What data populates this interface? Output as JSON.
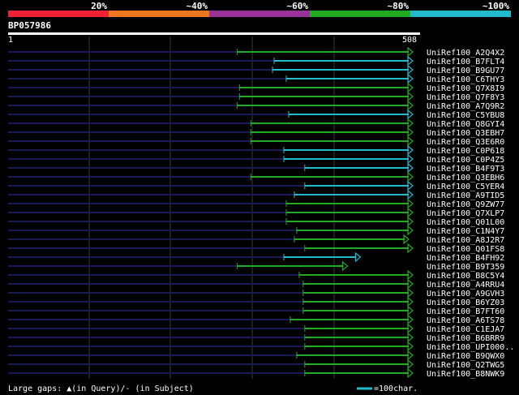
{
  "chart_data": {
    "type": "bar",
    "query_id": "BP057986",
    "query_length": 508,
    "scale_start": "1",
    "scale_end": "508",
    "identity_legend": [
      {
        "label": "20%",
        "color": "#ee2233"
      },
      {
        "label": "~40%",
        "color": "#ee7722"
      },
      {
        "label": "~60%",
        "color": "#993399"
      },
      {
        "label": "~80%",
        "color": "#22aa22"
      },
      {
        "label": "~100%",
        "color": "#22bbcc"
      }
    ],
    "gaps_legend": "Large gaps: ▲(in Query)/- (in Subject)",
    "scale_legend": "=100char.",
    "hits": [
      {
        "name": "UniRef100_A2Q4X2",
        "start": 285,
        "end": 503,
        "color": "#22aa22"
      },
      {
        "name": "UniRef100_B7FLT4",
        "start": 331,
        "end": 503,
        "color": "#22bbcc"
      },
      {
        "name": "UniRef100_B9GU77",
        "start": 329,
        "end": 503,
        "color": "#22bbcc"
      },
      {
        "name": "UniRef100_C6THY3",
        "start": 346,
        "end": 503,
        "color": "#22bbcc"
      },
      {
        "name": "UniRef100_Q7X8I9",
        "start": 288,
        "end": 503,
        "color": "#22aa22"
      },
      {
        "name": "UniRef100_Q7F8Y3",
        "start": 288,
        "end": 503,
        "color": "#22aa22"
      },
      {
        "name": "UniRef100_A7Q9R2",
        "start": 285,
        "end": 503,
        "color": "#22aa22"
      },
      {
        "name": "UniRef100_C5YBU8",
        "start": 349,
        "end": 503,
        "color": "#22bbcc"
      },
      {
        "name": "UniRef100_Q8GYI4",
        "start": 302,
        "end": 503,
        "color": "#22aa22"
      },
      {
        "name": "UniRef100_Q3EBH7",
        "start": 302,
        "end": 503,
        "color": "#22aa22"
      },
      {
        "name": "UniRef100_Q3E6R0",
        "start": 302,
        "end": 503,
        "color": "#22aa22"
      },
      {
        "name": "UniRef100_C0P618",
        "start": 343,
        "end": 503,
        "color": "#22bbcc"
      },
      {
        "name": "UniRef100_C0P4Z5",
        "start": 343,
        "end": 503,
        "color": "#22bbcc"
      },
      {
        "name": "UniRef100_B4F9T3",
        "start": 369,
        "end": 503,
        "color": "#22bbcc"
      },
      {
        "name": "UniRef100_Q3EBH6",
        "start": 302,
        "end": 503,
        "color": "#22aa22"
      },
      {
        "name": "UniRef100_C5YER4",
        "start": 369,
        "end": 503,
        "color": "#22bbcc"
      },
      {
        "name": "UniRef100_A9TID5",
        "start": 356,
        "end": 503,
        "color": "#22bbcc"
      },
      {
        "name": "UniRef100_Q9ZW77",
        "start": 346,
        "end": 503,
        "color": "#22aa22"
      },
      {
        "name": "UniRef100_Q7XLP7",
        "start": 346,
        "end": 503,
        "color": "#22aa22"
      },
      {
        "name": "UniRef100_Q01L00",
        "start": 346,
        "end": 503,
        "color": "#22aa22"
      },
      {
        "name": "UniRef100_C1N4Y7",
        "start": 359,
        "end": 503,
        "color": "#22aa22"
      },
      {
        "name": "UniRef100_A8J2R7",
        "start": 356,
        "end": 498,
        "color": "#22aa22"
      },
      {
        "name": "UniRef100_Q01FS8",
        "start": 369,
        "end": 503,
        "color": "#22aa22"
      },
      {
        "name": "UniRef100_B4FH92",
        "start": 343,
        "end": 438,
        "color": "#22bbcc"
      },
      {
        "name": "UniRef100_B9T359",
        "start": 285,
        "end": 422,
        "color": "#22aa22"
      },
      {
        "name": "UniRef100_B8C5Y4",
        "start": 362,
        "end": 503,
        "color": "#22aa22"
      },
      {
        "name": "UniRef100_A4RRU4",
        "start": 367,
        "end": 503,
        "color": "#22aa22"
      },
      {
        "name": "UniRef100_A9GVH3",
        "start": 367,
        "end": 503,
        "color": "#22aa22"
      },
      {
        "name": "UniRef100_B6YZ03",
        "start": 367,
        "end": 503,
        "color": "#22aa22"
      },
      {
        "name": "UniRef100_B7FT60",
        "start": 367,
        "end": 503,
        "color": "#22aa22"
      },
      {
        "name": "UniRef100_A6TS78",
        "start": 351,
        "end": 503,
        "color": "#22aa22"
      },
      {
        "name": "UniRef100_C1EJA7",
        "start": 369,
        "end": 503,
        "color": "#22aa22"
      },
      {
        "name": "UniRef100_B6BRR9",
        "start": 369,
        "end": 503,
        "color": "#22aa22"
      },
      {
        "name": "UniRef100_UPI000..",
        "start": 369,
        "end": 503,
        "color": "#22aa22"
      },
      {
        "name": "UniRef100_B9QWX0",
        "start": 359,
        "end": 503,
        "color": "#22aa22"
      },
      {
        "name": "UniRef100_Q2TWG5",
        "start": 369,
        "end": 503,
        "color": "#22aa22"
      },
      {
        "name": "UniRef100_B8NWK9",
        "start": 369,
        "end": 503,
        "color": "#22aa22"
      }
    ]
  }
}
